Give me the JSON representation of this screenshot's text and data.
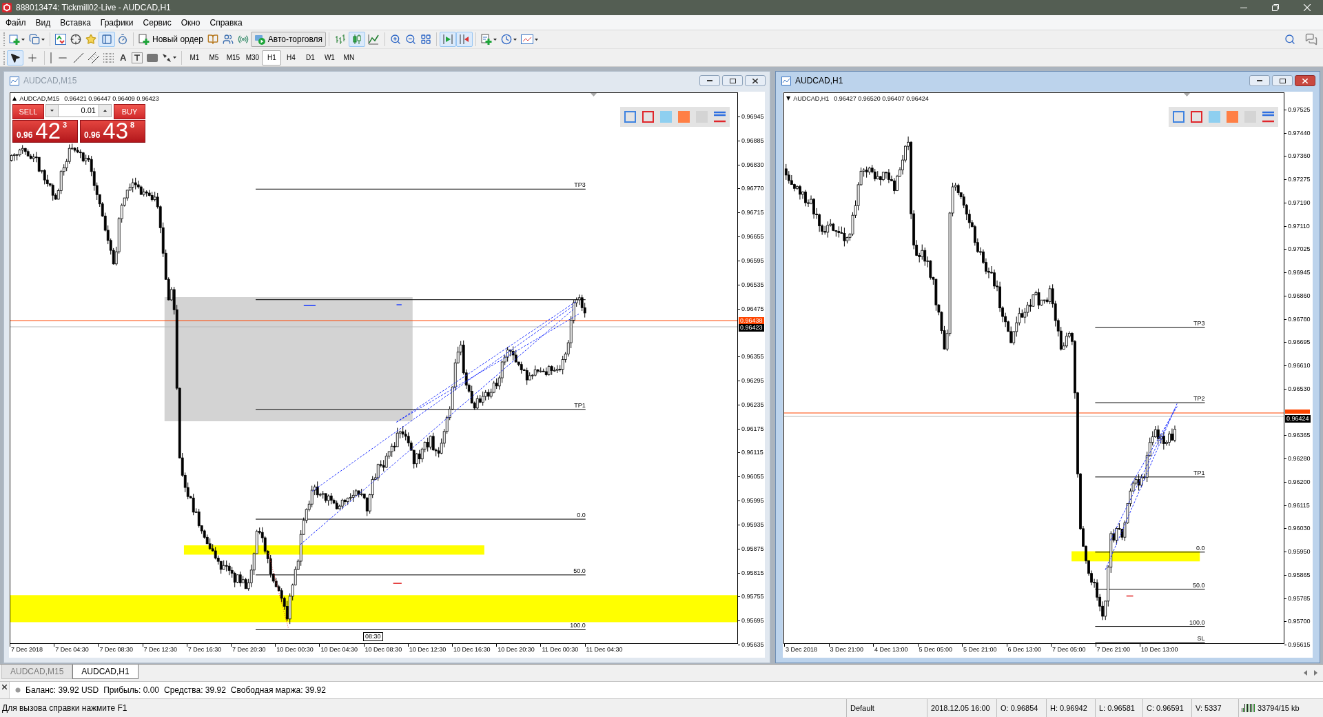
{
  "window": {
    "title": "888013474: Tickmill02-Live - AUDCAD,H1"
  },
  "menu": [
    "Файл",
    "Вид",
    "Вставка",
    "Графики",
    "Сервис",
    "Окно",
    "Справка"
  ],
  "toolbar": {
    "data_window": true,
    "new_order": "Новый ордер",
    "auto_trading": {
      "label": "Авто-торговля",
      "on": true
    },
    "chart_types": [
      {
        "selected": false
      },
      {
        "selected": true
      },
      {
        "selected": false
      }
    ],
    "auto_scroll": true,
    "chart_shift": true
  },
  "drawing_toolbar": {
    "tools": [
      {
        "selected": true
      },
      {
        "selected": false
      }
    ],
    "text_tool": "A",
    "timeframes": [
      {
        "label": "M1",
        "selected": false
      },
      {
        "label": "M5",
        "selected": false
      },
      {
        "label": "M15",
        "selected": false
      },
      {
        "label": "M30",
        "selected": false
      },
      {
        "label": "H1",
        "selected": true
      },
      {
        "label": "H4",
        "selected": false
      },
      {
        "label": "D1",
        "selected": false
      },
      {
        "label": "W1",
        "selected": false
      },
      {
        "label": "MN",
        "selected": false
      }
    ]
  },
  "charts": [
    {
      "title": "AUDCAD,M15",
      "active": false,
      "header": {
        "marker": "▲",
        "symbol": "AUDCAD,M15",
        "ohlc": "0.96421 0.96447 0.96409 0.96423"
      },
      "trade_panel": {
        "sell": "SELL",
        "buy": "BUY",
        "lot": "0.01",
        "bid": {
          "prefix": "0.96",
          "pips": "42",
          "fraction": "3"
        },
        "ask": {
          "prefix": "0.96",
          "pips": "43",
          "fraction": "8"
        }
      },
      "levels": [
        "TP3",
        "TP1",
        "0.0",
        "50.0",
        "100.0"
      ],
      "time_marker": "08:30",
      "price_axis": [
        "0.96945",
        "0.96885",
        "0.96830",
        "0.96770",
        "0.96715",
        "0.96655",
        "0.96595",
        "0.96535",
        "0.96475",
        "0.96355",
        "0.96295",
        "0.96235",
        "0.96175",
        "0.96115",
        "0.96055",
        "0.95995",
        "0.95935",
        "0.95875",
        "0.95815",
        "0.95755",
        "0.95695",
        "0.95635"
      ],
      "ask_label": "0.96438",
      "bid_label": "0.96423",
      "time_axis": [
        "7 Dec 2018",
        "7 Dec 04:30",
        "7 Dec 08:30",
        "7 Dec 12:30",
        "7 Dec 16:30",
        "7 Dec 20:30",
        "10 Dec 00:30",
        "10 Dec 04:30",
        "10 Dec 08:30",
        "10 Dec 12:30",
        "10 Dec 16:30",
        "10 Dec 20:30",
        "11 Dec 00:30",
        "11 Dec 04:30"
      ]
    },
    {
      "title": "AUDCAD,H1",
      "active": true,
      "header": {
        "marker": "▼",
        "symbol": "AUDCAD,H1",
        "ohlc": "0.96427 0.96520 0.96407 0.96424"
      },
      "levels": [
        "TP3",
        "TP2",
        "TP1",
        "0.0",
        "50.0",
        "100.0",
        "SL"
      ],
      "price_axis": [
        "0.97525",
        "0.97440",
        "0.97360",
        "0.97275",
        "0.97190",
        "0.97110",
        "0.97025",
        "0.96945",
        "0.96860",
        "0.96780",
        "0.96695",
        "0.96610",
        "0.96530",
        "0.96365",
        "0.96280",
        "0.96200",
        "0.96115",
        "0.96030",
        "0.95950",
        "0.95865",
        "0.95785",
        "0.95700",
        "0.95615"
      ],
      "bid_label": "0.96424",
      "time_axis": [
        "3 Dec 2018",
        "3 Dec 21:00",
        "4 Dec 13:00",
        "5 Dec 05:00",
        "5 Dec 21:00",
        "6 Dec 13:00",
        "7 Dec 05:00",
        "7 Dec 21:00",
        "10 Dec 13:00"
      ]
    }
  ],
  "chart_tabs": [
    {
      "label": "AUDCAD,M15",
      "selected": false
    },
    {
      "label": "AUDCAD,H1",
      "selected": true
    }
  ],
  "terminal": {
    "account": [
      "Баланс: 39.92 USD",
      "Прибыль: 0.00",
      "Средства: 39.92",
      "Свободная маржа: 39.92"
    ]
  },
  "status_bar": {
    "help": "Для вызова справки нажмите F1",
    "cells": [
      "Default",
      "2018.12.05 16:00",
      "O: 0.96854",
      "H: 0.96942",
      "L: 0.96581",
      "C: 0.96591",
      "V: 5337"
    ],
    "traffic": "33794/15 kb"
  }
}
